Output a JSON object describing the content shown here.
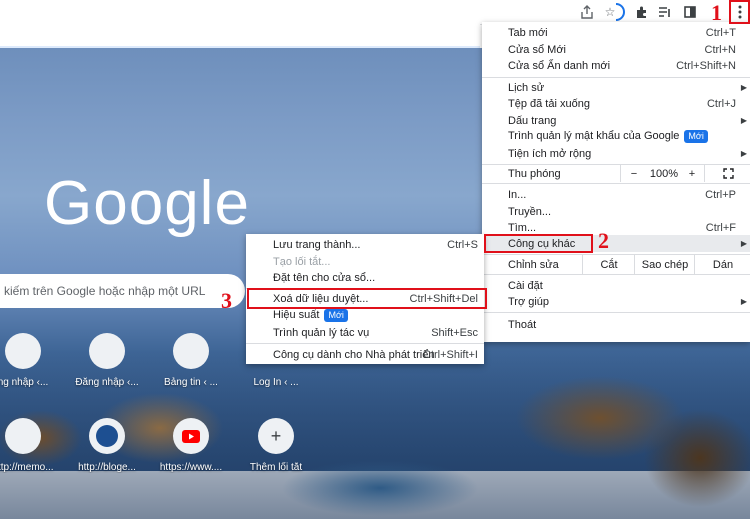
{
  "ntp": {
    "logo": "Google",
    "search_placeholder": "kiếm trên Google hoặc nhập một URL",
    "shortcuts_row1": [
      "ng nhập ‹...",
      "Đăng nhập ‹...",
      "Bảng tin ‹ ...",
      "Log In ‹ ..."
    ],
    "shortcuts_row2": [
      "http://memo...",
      "http://bloge...",
      "https://www....",
      "Thêm lối tắt"
    ]
  },
  "menu": {
    "new_tab": "Tab mới",
    "new_tab_key": "Ctrl+T",
    "new_window": "Cửa sổ Mới",
    "new_window_key": "Ctrl+N",
    "incognito": "Cửa sổ Ẩn danh mới",
    "incognito_key": "Ctrl+Shift+N",
    "history": "Lịch sử",
    "downloads": "Tệp đã tải xuống",
    "downloads_key": "Ctrl+J",
    "bookmarks": "Dấu trang",
    "password_manager": "Trình quản lý mật khẩu của Google",
    "new_badge": "Mới",
    "extensions": "Tiện ích mở rộng",
    "zoom": "Thu phóng",
    "zoom_minus": "−",
    "zoom_value": "100%",
    "zoom_plus": "+",
    "print": "In...",
    "print_key": "Ctrl+P",
    "cast": "Truyền...",
    "find": "Tìm...",
    "find_key": "Ctrl+F",
    "more_tools": "Công cụ khác",
    "edit": "Chỉnh sửa",
    "cut": "Cắt",
    "copy": "Sao chép",
    "paste": "Dán",
    "settings": "Cài đặt",
    "help": "Trợ giúp",
    "exit": "Thoát"
  },
  "submenu": {
    "save_page": "Lưu trang thành...",
    "save_page_key": "Ctrl+S",
    "create_shortcut": "Tạo lối tắt...",
    "name_window": "Đặt tên cho cửa sổ...",
    "clear_data": "Xoá dữ liệu duyệt...",
    "clear_data_key": "Ctrl+Shift+Del",
    "performance": "Hiệu suất",
    "new_badge": "Mới",
    "task_manager": "Trình quản lý tác vụ",
    "task_manager_key": "Shift+Esc",
    "dev_tools": "Công cụ dành cho Nhà phát triển",
    "dev_tools_key": "Ctrl+Shift+I"
  },
  "annotations": {
    "step1": "1",
    "step2": "2",
    "step3": "3",
    "color": "#e0101a"
  },
  "icons": [
    "share-icon",
    "star-icon",
    "extensions-icon",
    "reading-list-icon",
    "side-panel-icon",
    "profile-ring-icon",
    "kebab-menu-icon",
    "fullscreen-icon",
    "submenu-arrow-icon",
    "youtube-icon",
    "plus-icon"
  ]
}
